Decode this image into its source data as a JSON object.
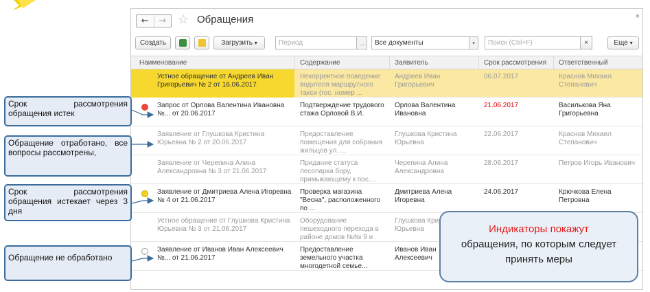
{
  "window": {
    "title": "Обращения",
    "close": "×"
  },
  "toolbar": {
    "create": "Создать",
    "load": "Загрузить",
    "load_caret": "▾",
    "period_placeholder": "Период",
    "period_btn": "...",
    "docs_value": "Все документы",
    "docs_caret": "▾",
    "search_placeholder": "Поиск (Ctrl+F)",
    "search_clear": "×",
    "more": "Еще",
    "more_caret": "▾"
  },
  "icons": {
    "back": "←",
    "forward": "→",
    "star": "☆",
    "excel": "excel-icon",
    "mail": "mail-icon"
  },
  "columns": [
    "Наименование",
    "Содержание",
    "Заявитель",
    "Срок рассмотрения",
    "Ответственный"
  ],
  "rows": [
    {
      "name": "Устное обращение от Андреев Иван Григорьевич № 2 от 16.06.2017",
      "content": "Некорректное поведение водителя маршрутного такси (гос. номер ...",
      "applicant": "Андреев Иван Григорьевич",
      "deadline": "06.07.2017",
      "responsible": "Краснов Михаил Степанович",
      "status": "selected"
    },
    {
      "name": "Запрос от Орлова Валентина Ивановна №... от 20.06.2017",
      "content": "Подтверждение трудового стажа Орловой В.И.",
      "applicant": "Орлова Валентина Ивановна",
      "deadline": "21.06.2017",
      "responsible": "Василькова Яна Григорьевна",
      "status": "expired"
    },
    {
      "name": "Заявление от Глушкова Кристина Юрьевна № 2 от 20.06.2017",
      "content": "Предоставление помещения для собрания жильцов ул. ...",
      "applicant": "Глушкова Кристина Юрьевна",
      "deadline": "22.06.2017",
      "responsible": "Краснов Михаил Степанович",
      "status": "done"
    },
    {
      "name": "Заявление от Черепина Алина Александровна № 3 от 21.06.2017",
      "content": "Придание статуса лесопарка бору, примыкающему к пос....",
      "applicant": "Черепина Алина Александровна",
      "deadline": "28.06.2017",
      "responsible": "Петров Игорь Иванович",
      "status": "done"
    },
    {
      "name": "Заявление от Дмитриева Алена Игоревна № 4 от 21.06.2017",
      "content": "Проверка магазина \"Весна\", расположенного по ...",
      "applicant": "Дмитриева Алена Игоревна",
      "deadline": "24.06.2017",
      "responsible": "Крючкова Елена Петровна",
      "status": "soon"
    },
    {
      "name": "Устное обращение от Глушкова Кристина Юрьевна № 3 от 21.06.2017",
      "content": "Оборудование пешеходного перехода в районе домов №№ 9 и",
      "applicant": "Глушкова Кристина Юрьевна",
      "deadline": "",
      "responsible": "",
      "status": "done"
    },
    {
      "name": "Заявление от Иванов Иван Алексеевич №... от 21.06.2017",
      "content": "Предоставление земельного участка многодетной семье...",
      "applicant": "Иванов Иван Алексеевич",
      "deadline": "",
      "responsible": "",
      "status": "new"
    }
  ],
  "callouts": {
    "expired": "Срок рассмотрения обращения истек",
    "done": "Обращение отработано, все вопросы рассмотрены,",
    "soon": "Срок рассмотрения обращения истекает через 3 дня",
    "new": "Обращение не обработано"
  },
  "info": {
    "highlight": "Индикаторы покажут",
    "rest": "обращения, по которым следует принять меры"
  },
  "colors": {
    "selected_row": "#fbe8a2",
    "selected_cell": "#f6d82f",
    "expired": "#e8473c",
    "soon": "#f4d21f",
    "deadline_red": "#e00000",
    "accent_blue": "#3a6c9c"
  }
}
